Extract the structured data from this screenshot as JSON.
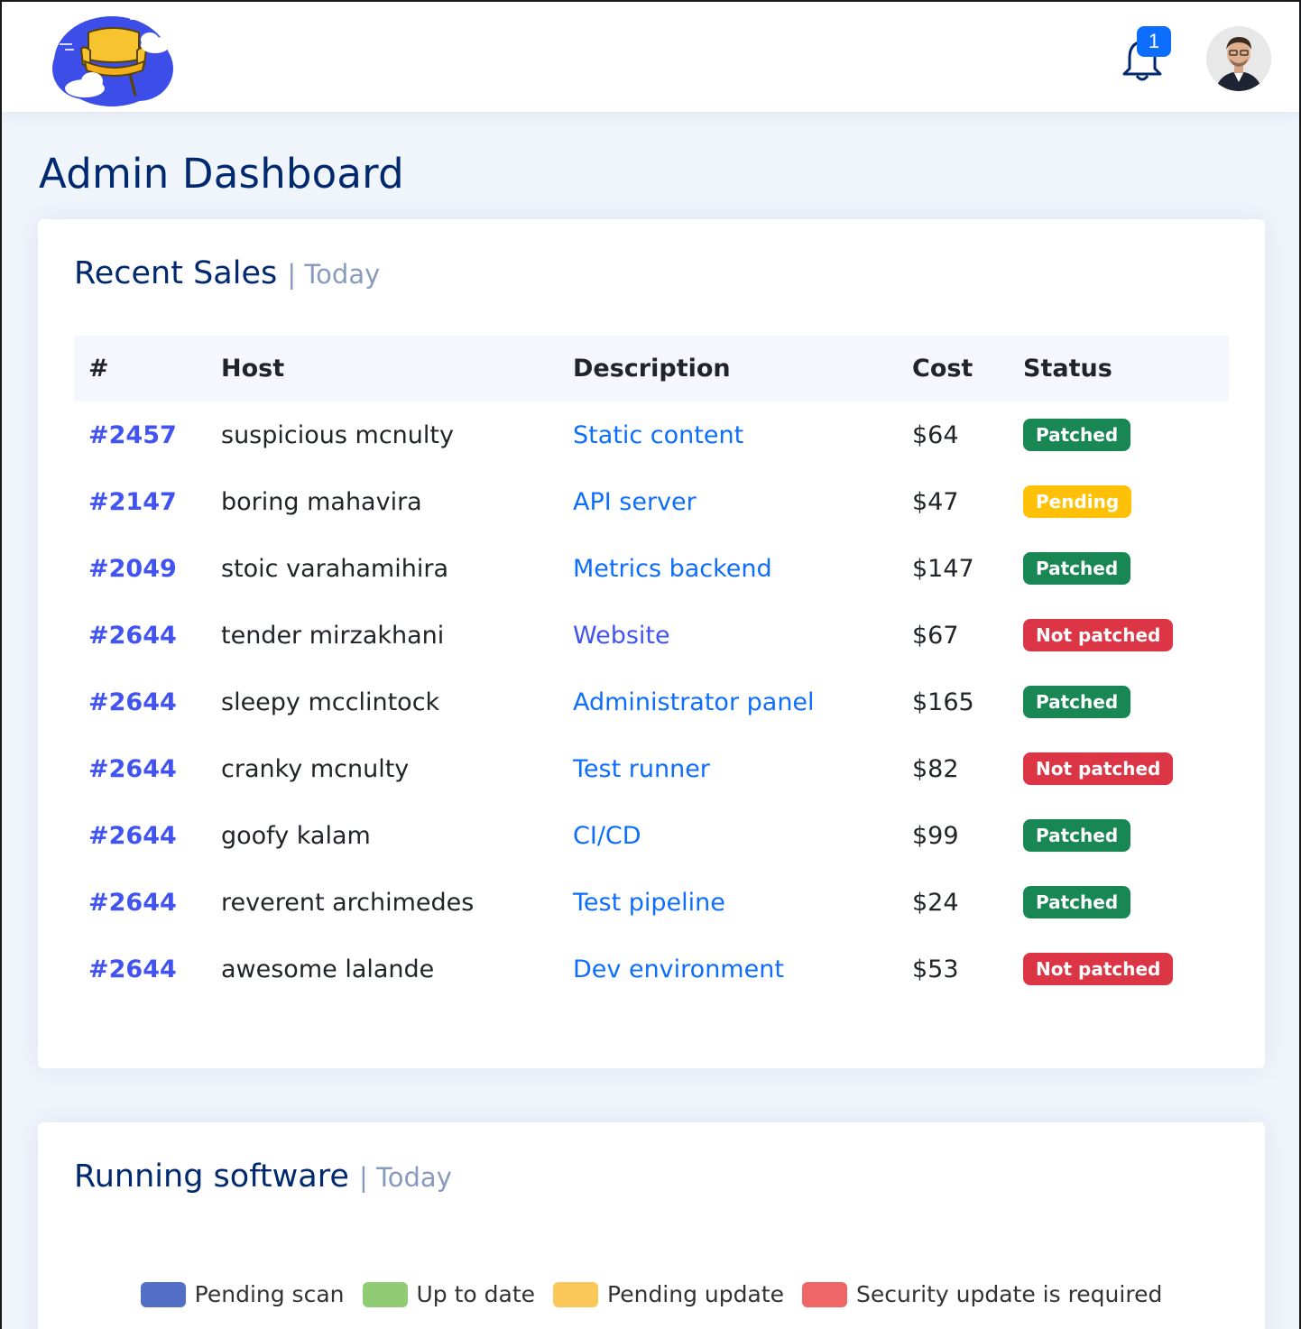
{
  "header": {
    "notification_count": "1"
  },
  "page_title": "Admin Dashboard",
  "sales": {
    "title": "Recent Sales",
    "subtitle": "| Today",
    "columns": [
      "#",
      "Host",
      "Description",
      "Cost",
      "Status"
    ],
    "rows": [
      {
        "id": "#2457",
        "host": "suspicious mcnulty",
        "description": "Static content",
        "cost": "$64",
        "status": "Patched",
        "status_color": "#198754"
      },
      {
        "id": "#2147",
        "host": "boring mahavira",
        "description": "API server",
        "cost": "$47",
        "status": "Pending",
        "status_color": "#ffc107"
      },
      {
        "id": "#2049",
        "host": "stoic varahamihira",
        "description": "Metrics backend",
        "cost": "$147",
        "status": "Patched",
        "status_color": "#198754"
      },
      {
        "id": "#2644",
        "host": "tender mirzakhani",
        "description": "Website",
        "cost": "$67",
        "status": "Not patched",
        "status_color": "#dc3545"
      },
      {
        "id": "#2644",
        "host": "sleepy mcclintock",
        "description": "Administrator panel",
        "cost": "$165",
        "status": "Patched",
        "status_color": "#198754"
      },
      {
        "id": "#2644",
        "host": "cranky mcnulty",
        "description": "Test runner",
        "cost": "$82",
        "status": "Not patched",
        "status_color": "#dc3545"
      },
      {
        "id": "#2644",
        "host": "goofy kalam",
        "description": "CI/CD",
        "cost": "$99",
        "status": "Patched",
        "status_color": "#198754"
      },
      {
        "id": "#2644",
        "host": "reverent archimedes",
        "description": "Test pipeline",
        "cost": "$24",
        "status": "Patched",
        "status_color": "#198754"
      },
      {
        "id": "#2644",
        "host": "awesome lalande",
        "description": "Dev environment",
        "cost": "$53",
        "status": "Not patched",
        "status_color": "#dc3545"
      }
    ]
  },
  "software": {
    "title": "Running software",
    "subtitle": "| Today",
    "legend": [
      {
        "label": "Pending scan",
        "color": "#5470c6"
      },
      {
        "label": "Up to date",
        "color": "#91cc75"
      },
      {
        "label": "Pending update",
        "color": "#fac858"
      },
      {
        "label": "Security update is required",
        "color": "#ee6666"
      }
    ]
  }
}
